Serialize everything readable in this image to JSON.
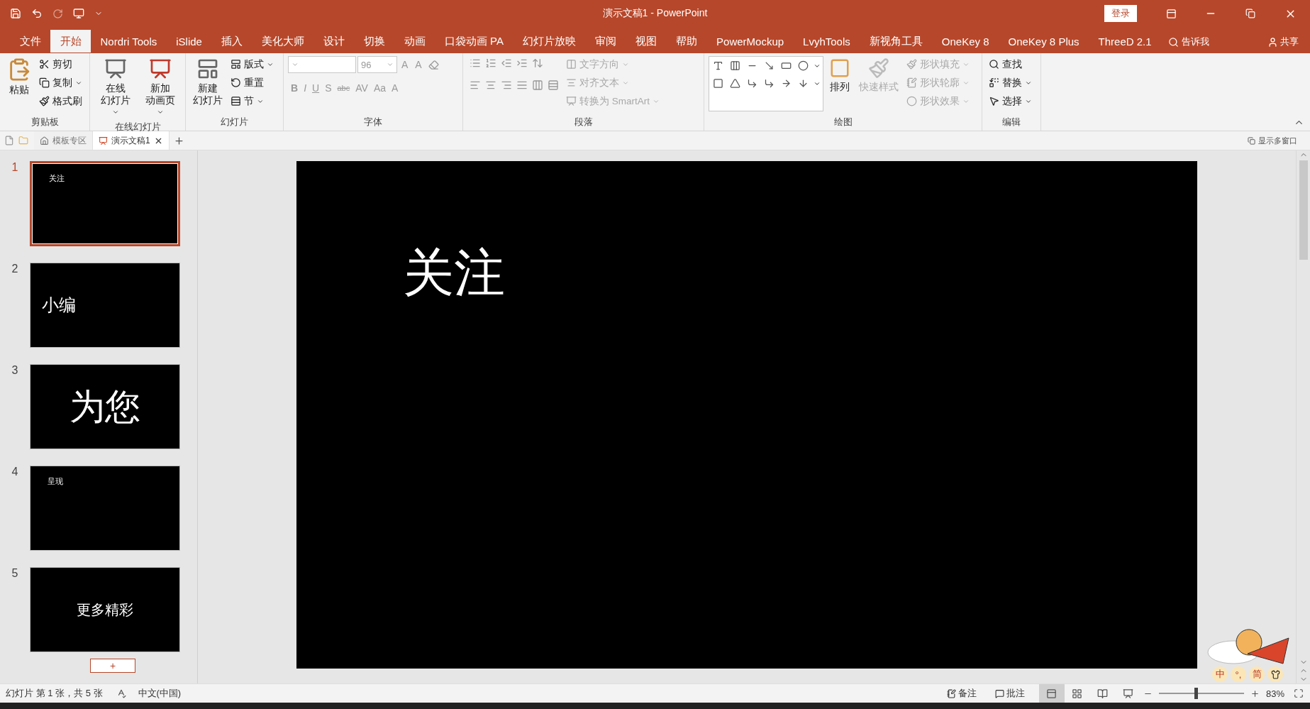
{
  "window": {
    "title": "演示文稿1  -  PowerPoint",
    "login": "登录"
  },
  "menu_tabs": [
    {
      "label": "文件",
      "selected": false
    },
    {
      "label": "开始",
      "selected": true
    },
    {
      "label": "Nordri Tools",
      "selected": false
    },
    {
      "label": "iSlide",
      "selected": false
    },
    {
      "label": "插入",
      "selected": false
    },
    {
      "label": "美化大师",
      "selected": false
    },
    {
      "label": "设计",
      "selected": false
    },
    {
      "label": "切换",
      "selected": false
    },
    {
      "label": "动画",
      "selected": false
    },
    {
      "label": "口袋动画 PA",
      "selected": false
    },
    {
      "label": "幻灯片放映",
      "selected": false
    },
    {
      "label": "审阅",
      "selected": false
    },
    {
      "label": "视图",
      "selected": false
    },
    {
      "label": "帮助",
      "selected": false
    },
    {
      "label": "PowerMockup",
      "selected": false
    },
    {
      "label": "LvyhTools",
      "selected": false
    },
    {
      "label": "新视角工具",
      "selected": false
    },
    {
      "label": "OneKey 8",
      "selected": false
    },
    {
      "label": "OneKey 8 Plus",
      "selected": false
    },
    {
      "label": "ThreeD 2.1",
      "selected": false
    }
  ],
  "tell_me": "告诉我",
  "share": "共享",
  "ribbon": {
    "clipboard": {
      "label": "剪贴板",
      "paste": "粘贴",
      "items": [
        {
          "label": "剪切",
          "dropdown": false,
          "disabled": false
        },
        {
          "label": "复制",
          "dropdown": true,
          "disabled": false
        },
        {
          "label": "格式刷",
          "dropdown": false,
          "disabled": false
        }
      ]
    },
    "online": {
      "label": "在线幻灯片",
      "buttons": [
        {
          "lines": [
            "在线",
            "幻灯片"
          ],
          "dropdown": true
        },
        {
          "lines": [
            "新加",
            "动画页"
          ],
          "dropdown": true
        }
      ]
    },
    "slides": {
      "label": "幻灯片",
      "new": [
        "新建",
        "幻灯片"
      ],
      "items": [
        {
          "label": "版式",
          "dropdown": true,
          "disabled": false
        },
        {
          "label": "重置",
          "dropdown": false,
          "disabled": false
        },
        {
          "label": "节",
          "dropdown": true,
          "disabled": false
        }
      ]
    },
    "font": {
      "label": "字体",
      "font_size": "96",
      "sizers": [
        "A",
        "A"
      ],
      "format": [
        "B",
        "I",
        "U",
        "S",
        "abc",
        "AV",
        "Aa",
        "A"
      ]
    },
    "paragraph": {
      "label": "段落",
      "items": [
        {
          "label": "文字方向",
          "dropdown": true,
          "disabled": true
        },
        {
          "label": "对齐文本",
          "dropdown": true,
          "disabled": true
        },
        {
          "label": "转换为 SmartArt",
          "dropdown": true,
          "disabled": true
        }
      ]
    },
    "drawing": {
      "label": "绘图",
      "arrange": "排列",
      "quick_styles": "快速样式",
      "items": [
        {
          "label": "形状填充",
          "dropdown": true,
          "disabled": true
        },
        {
          "label": "形状轮廓",
          "dropdown": true,
          "disabled": true
        },
        {
          "label": "形状效果",
          "dropdown": true,
          "disabled": true
        }
      ]
    },
    "editing": {
      "label": "编辑",
      "items": [
        {
          "label": "查找",
          "dropdown": false,
          "disabled": false
        },
        {
          "label": "替换",
          "dropdown": true,
          "disabled": false
        },
        {
          "label": "选择",
          "dropdown": true,
          "disabled": false
        }
      ]
    }
  },
  "doc_tabs": [
    {
      "label": "模板专区",
      "kind": "home",
      "selected": false
    },
    {
      "label": "演示文稿1",
      "kind": "doc",
      "selected": true
    }
  ],
  "multi_window": "显示多窗口",
  "slides": [
    {
      "number": "1",
      "text": "关注",
      "kind": "caption",
      "selected": true
    },
    {
      "number": "2",
      "text": "小编",
      "kind": "heading",
      "selected": false
    },
    {
      "number": "3",
      "text": "为您",
      "kind": "title",
      "selected": false
    },
    {
      "number": "4",
      "text": "呈现",
      "kind": "caption",
      "selected": false
    },
    {
      "number": "5",
      "text": "更多精彩",
      "kind": "subtitle",
      "selected": false
    }
  ],
  "add_slide": "+",
  "current_slide": {
    "text": "关注"
  },
  "ime": {
    "mode": "中",
    "punct": "°,",
    "script": "简"
  },
  "status_bar": {
    "slide_info": "幻灯片 第 1 张，共 5 张",
    "language": "中文(中国)",
    "notes": "备注",
    "comments": "批注",
    "views": [
      {
        "kind": "normal",
        "selected": true
      },
      {
        "kind": "sorter",
        "selected": false
      },
      {
        "kind": "reading",
        "selected": false
      },
      {
        "kind": "show",
        "selected": false
      }
    ],
    "zoom": {
      "level": 0.42
    },
    "zoom_text": "83%"
  }
}
